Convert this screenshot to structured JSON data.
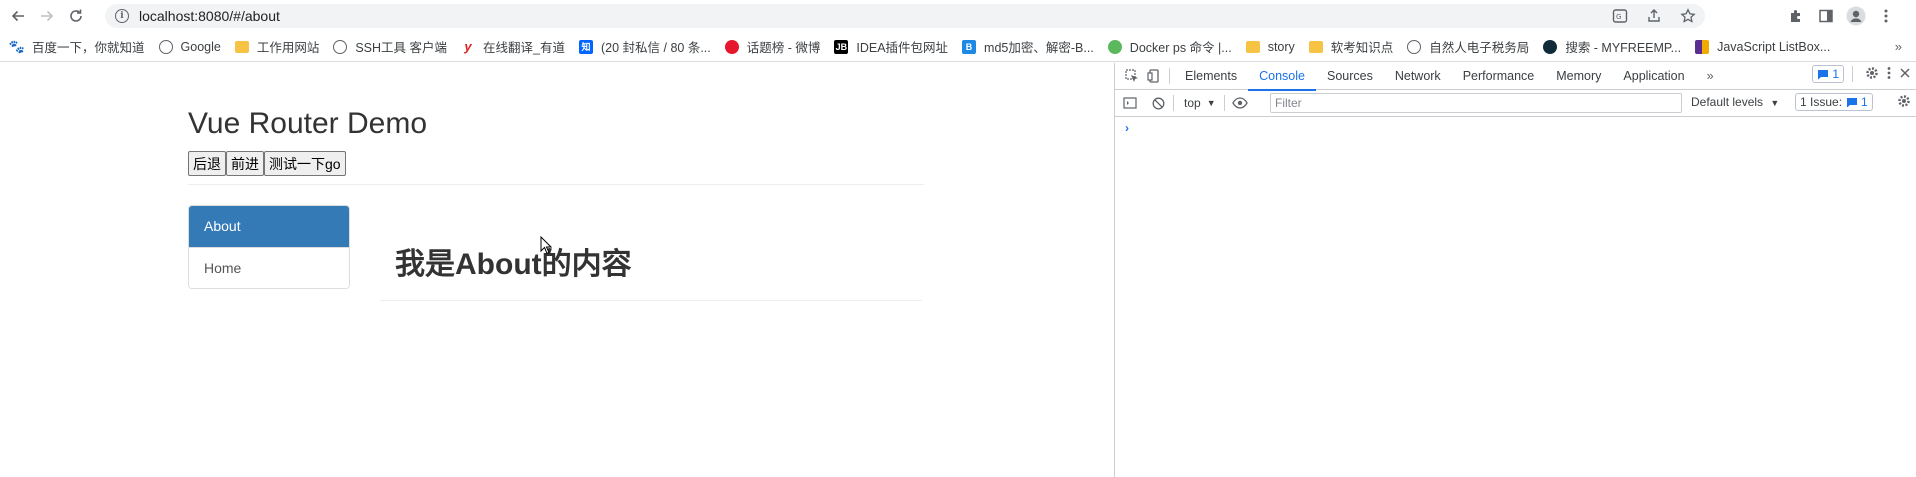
{
  "browser": {
    "url": "localhost:8080/#/about",
    "bookmarks": [
      {
        "label": "百度一下，你就知道",
        "icon": "paw-icon",
        "color": "#2932e1"
      },
      {
        "label": "Google",
        "icon": "globe-icon",
        "color": "#5f6368"
      },
      {
        "label": "工作用网站",
        "icon": "folder-icon",
        "color": "#f6c344"
      },
      {
        "label": "SSH工具 客户端",
        "icon": "globe-icon",
        "color": "#5f6368"
      },
      {
        "label": "在线翻译_有道",
        "icon": "youdao-icon",
        "color": "#e02020"
      },
      {
        "label": "(20 封私信 / 80 条...",
        "icon": "zhihu-icon",
        "color": "#0066ff"
      },
      {
        "label": "话题榜 - 微博",
        "icon": "weibo-icon",
        "color": "#e6162d"
      },
      {
        "label": "IDEA插件包网址",
        "icon": "jetbrains-icon",
        "color": "#000000"
      },
      {
        "label": "md5加密、解密-B...",
        "icon": "b-icon",
        "color": "#1e88e5"
      },
      {
        "label": "Docker ps 命令 |...",
        "icon": "runoob-icon",
        "color": "#5cb85c"
      },
      {
        "label": "story",
        "icon": "folder-icon",
        "color": "#f6c344"
      },
      {
        "label": "软考知识点",
        "icon": "folder-icon",
        "color": "#f6c344"
      },
      {
        "label": "自然人电子税务局",
        "icon": "globe-icon",
        "color": "#5f6368"
      },
      {
        "label": "搜索 - MYFREEMP...",
        "icon": "music-icon",
        "color": "#0f2b3a"
      },
      {
        "label": "JavaScript ListBox...",
        "icon": "grid-icon",
        "color": "#5c2d91"
      }
    ]
  },
  "page": {
    "title": "Vue Router Demo",
    "buttons": {
      "back": "后退",
      "forward": "前进",
      "go": "测试一下go"
    },
    "nav": {
      "about": "About",
      "home": "Home"
    },
    "content_title": "我是About的内容"
  },
  "devtools": {
    "tabs": [
      "Elements",
      "Console",
      "Sources",
      "Network",
      "Performance",
      "Memory",
      "Application"
    ],
    "active_tab": "Console",
    "message_count": "1",
    "context": "top",
    "filter_placeholder": "Filter",
    "levels": "Default levels",
    "issues_label": "1 Issue:",
    "issues_count": "1",
    "prompt": "›"
  },
  "colors": {
    "accent": "#1a73e8",
    "active_nav": "#337ab7"
  }
}
